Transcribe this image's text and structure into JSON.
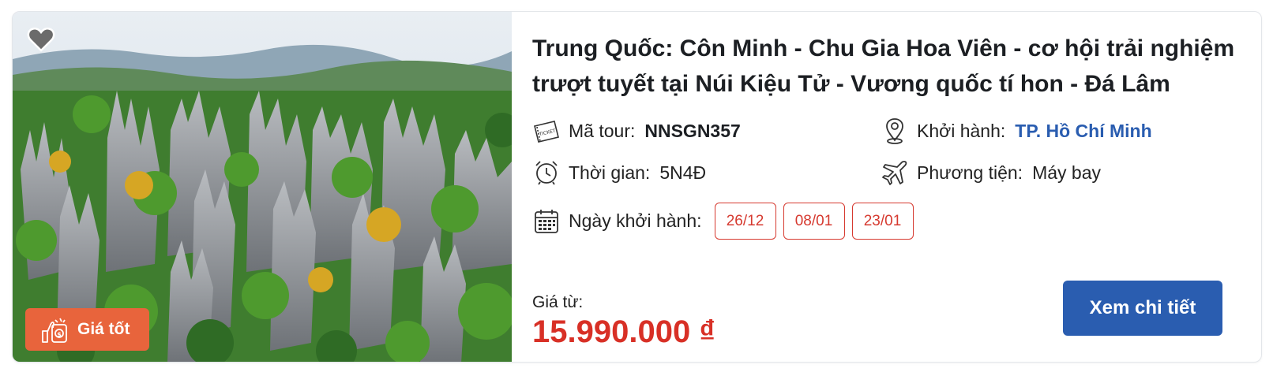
{
  "tour": {
    "title": "Trung Quốc: Côn Minh - Chu Gia Hoa Viên - cơ hội trải nghiệm trượt tuyết tại Núi Kiệu Tử - Vương quốc tí hon - Đá Lâm",
    "badge": {
      "label": "Giá tốt",
      "icon": "thumbs-up-money-icon"
    },
    "favorite_icon": "heart-icon",
    "code": {
      "label": "Mã tour:",
      "value": "NNSGN357",
      "icon": "ticket-icon"
    },
    "departure": {
      "label": "Khởi hành:",
      "value": "TP. Hồ Chí Minh",
      "icon": "location-pin-icon"
    },
    "duration": {
      "label": "Thời gian:",
      "value": "5N4Đ",
      "icon": "alarm-clock-icon"
    },
    "transport": {
      "label": "Phương tiện:",
      "value": "Máy bay",
      "icon": "airplane-icon"
    },
    "departure_dates": {
      "label": "Ngày khởi hành:",
      "icon": "calendar-icon",
      "dates": [
        "26/12",
        "08/01",
        "23/01"
      ]
    },
    "price": {
      "label": "Giá từ:",
      "value": "15.990.000 ₫"
    },
    "cta": {
      "label": "Xem chi tiết"
    }
  },
  "colors": {
    "brand_blue": "#2a5db0",
    "price_red": "#d83026",
    "badge_orange": "#e8643c",
    "chip_red": "#d63a30"
  }
}
